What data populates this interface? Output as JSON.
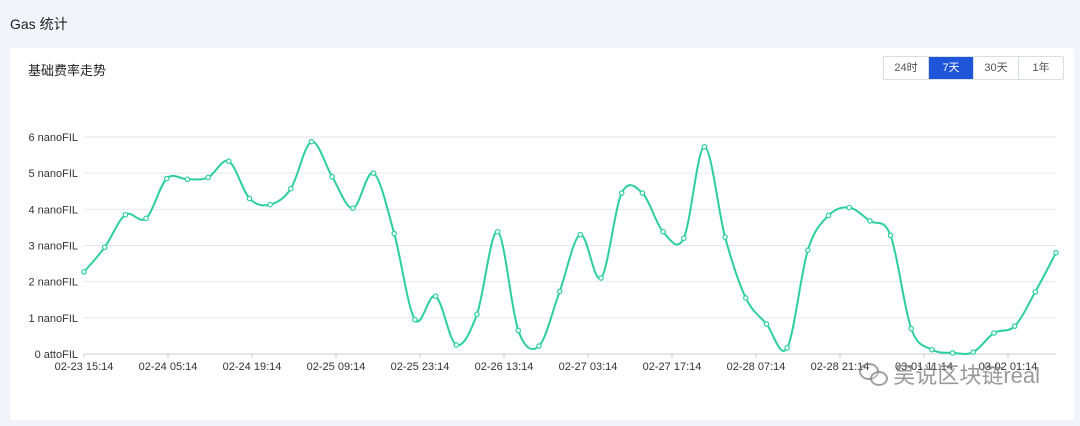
{
  "page": {
    "title": "Gas 统计"
  },
  "card": {
    "title": "基础费率走势",
    "tabs": [
      {
        "label": "24时",
        "active": false
      },
      {
        "label": "7天",
        "active": true
      },
      {
        "label": "30天",
        "active": false
      },
      {
        "label": "1年",
        "active": false
      }
    ]
  },
  "watermark": {
    "text": "吴说区块链real",
    "icon": "wechat-icon"
  },
  "colors": {
    "line": "#2ccf9f",
    "accent": "#1f55d9",
    "grid": "#e3e6ec"
  },
  "chart_data": {
    "type": "line",
    "ylim": [
      0,
      6
    ],
    "y_ticks": [
      {
        "value": 0,
        "label": "0 attoFIL"
      },
      {
        "value": 1,
        "label": "1 nanoFIL"
      },
      {
        "value": 2,
        "label": "2 nanoFIL"
      },
      {
        "value": 3,
        "label": "3 nanoFIL"
      },
      {
        "value": 4,
        "label": "4 nanoFIL"
      },
      {
        "value": 5,
        "label": "5 nanoFIL"
      },
      {
        "value": 6,
        "label": "6 nanoFIL"
      }
    ],
    "x_tick_labels": [
      {
        "index": 0,
        "label": "02-23 15:14"
      },
      {
        "index": 7,
        "label": "02-24 05:14"
      },
      {
        "index": 14,
        "label": "02-24 19:14"
      },
      {
        "index": 21,
        "label": "02-25 09:14"
      },
      {
        "index": 28,
        "label": "02-25 23:14"
      },
      {
        "index": 35,
        "label": "02-26 13:14"
      },
      {
        "index": 42,
        "label": "02-27 03:14"
      },
      {
        "index": 49,
        "label": "02-27 17:14"
      },
      {
        "index": 56,
        "label": "02-28 07:14"
      },
      {
        "index": 63,
        "label": "02-28 21:14"
      },
      {
        "index": 70,
        "label": "03-01 11:14"
      },
      {
        "index": 77,
        "label": "03-02 01:14"
      }
    ],
    "point_count": 82,
    "series": [
      {
        "values": [
          2.27,
          2.95,
          3.85,
          3.75,
          4.85,
          4.83,
          4.88,
          5.33,
          4.3,
          4.13,
          4.57,
          5.87,
          4.9,
          4.03,
          5.0,
          3.33,
          0.95,
          1.6,
          0.25,
          1.1,
          3.38,
          0.65,
          0.22,
          1.73,
          3.3,
          2.1,
          4.45,
          4.45,
          3.38,
          3.2,
          5.73,
          3.23,
          1.55,
          0.83,
          0.17,
          2.87,
          3.83,
          4.05,
          3.68,
          3.28,
          0.7,
          0.12,
          0.03,
          0.05,
          0.58,
          0.77,
          1.72,
          2.8
        ]
      }
    ]
  }
}
